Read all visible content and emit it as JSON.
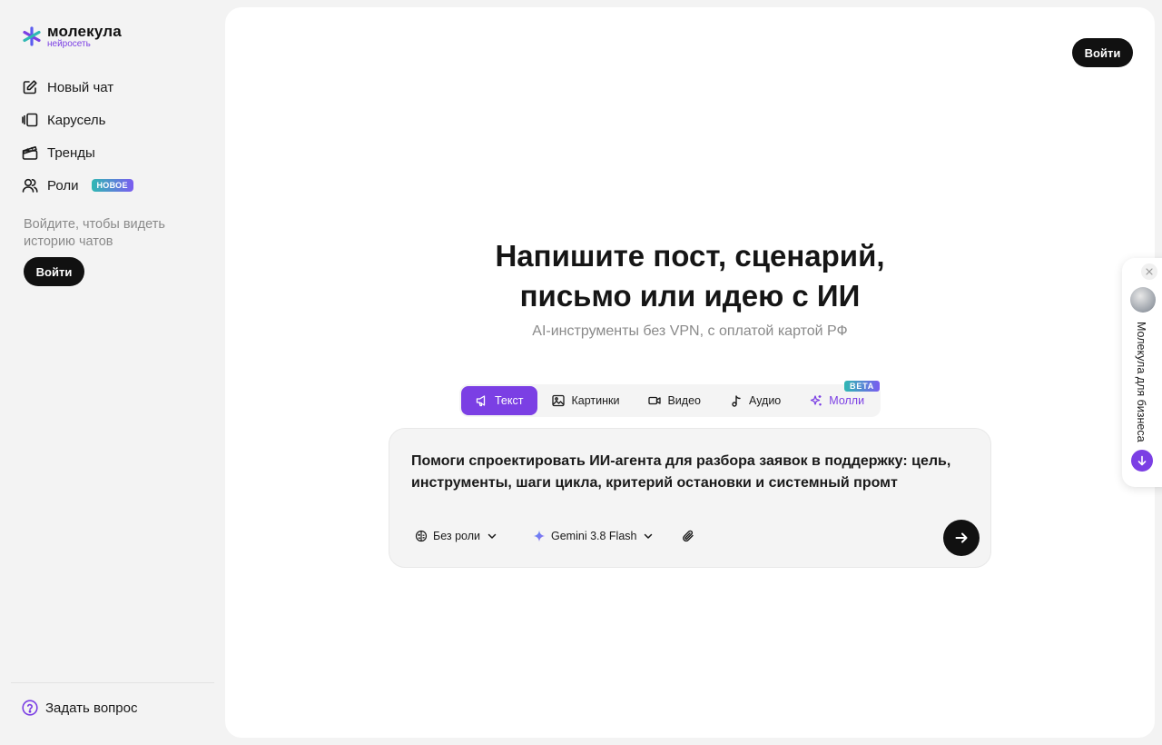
{
  "brand": {
    "name": "молекула",
    "subtitle": "нейросеть",
    "accent": "#7b3fe4"
  },
  "sidebar": {
    "items": [
      {
        "label": "Новый чат",
        "icon": "edit-icon"
      },
      {
        "label": "Карусель",
        "icon": "carousel-icon"
      },
      {
        "label": "Тренды",
        "icon": "clapper-icon"
      },
      {
        "label": "Роли",
        "icon": "users-icon",
        "badge": "НОВОЕ"
      }
    ],
    "login_hint": "Войдите, чтобы видеть историю чатов",
    "login_label": "Войти",
    "ask_label": "Задать вопрос"
  },
  "header": {
    "login_label": "Войти"
  },
  "hero": {
    "title_line1": "Напишите пост, сценарий,",
    "title_line2": "письмо или идею с ИИ",
    "subtitle": "AI-инструменты без VPN, с оплатой картой РФ"
  },
  "tabs": [
    {
      "label": "Текст",
      "icon": "megaphone-icon",
      "active": true
    },
    {
      "label": "Картинки",
      "icon": "image-icon"
    },
    {
      "label": "Видео",
      "icon": "video-icon"
    },
    {
      "label": "Аудио",
      "icon": "music-note-icon"
    },
    {
      "label": "Молли",
      "icon": "sparkles-icon",
      "badge": "BETA"
    }
  ],
  "composer": {
    "prompt": "Помоги спроектировать ИИ-агента для разбора заявок в поддержку: цель, инструменты, шаги цикла, критерий остановки и системный промт",
    "role_label": "Без роли",
    "model_label": "Gemini 3.8 Flash"
  },
  "business_widget": {
    "label": "Молекула для бизнеса"
  }
}
